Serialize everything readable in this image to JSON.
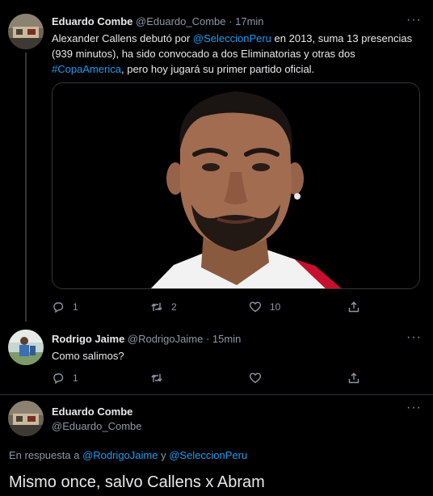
{
  "tweet1": {
    "name": "Eduardo Combe",
    "handle": "@Eduardo_Combe",
    "sep": "·",
    "time": "17min",
    "more": "···",
    "text_a": "Alexander Callens debutó por ",
    "link_a": "@SeleccionPeru",
    "text_b": " en 2013, suma 13 presencias (939 minutos), ha sido convocado a dos Eliminatorias y otras dos ",
    "link_b": "#CopaAmerica",
    "text_c": ", pero hoy jugará su primer partido oficial.",
    "replies": "1",
    "retweets": "2",
    "likes": "10"
  },
  "tweet2": {
    "name": "Rodrigo Jaime",
    "handle": "@RodrigoJaime",
    "sep": "·",
    "time": "15min",
    "more": "···",
    "text": "Como salimos?",
    "replies": "1"
  },
  "tweet3": {
    "name": "Eduardo Combe",
    "handle": "@Eduardo_Combe",
    "more": "···",
    "reply_prefix": "En respuesta a ",
    "reply_user1": "@RodrigoJaime",
    "reply_and": " y ",
    "reply_user2": "@SeleccionPeru",
    "text": "Mismo once, salvo Callens x Abram"
  },
  "icons": {
    "reply": "reply-icon",
    "retweet": "retweet-icon",
    "like": "heart-icon",
    "share": "share-icon",
    "more": "more-icon"
  },
  "colors": {
    "background": "#000000",
    "link": "#1d9bf0",
    "secondary_text": "#8b98a5",
    "primary_text": "#e7e9ea"
  }
}
